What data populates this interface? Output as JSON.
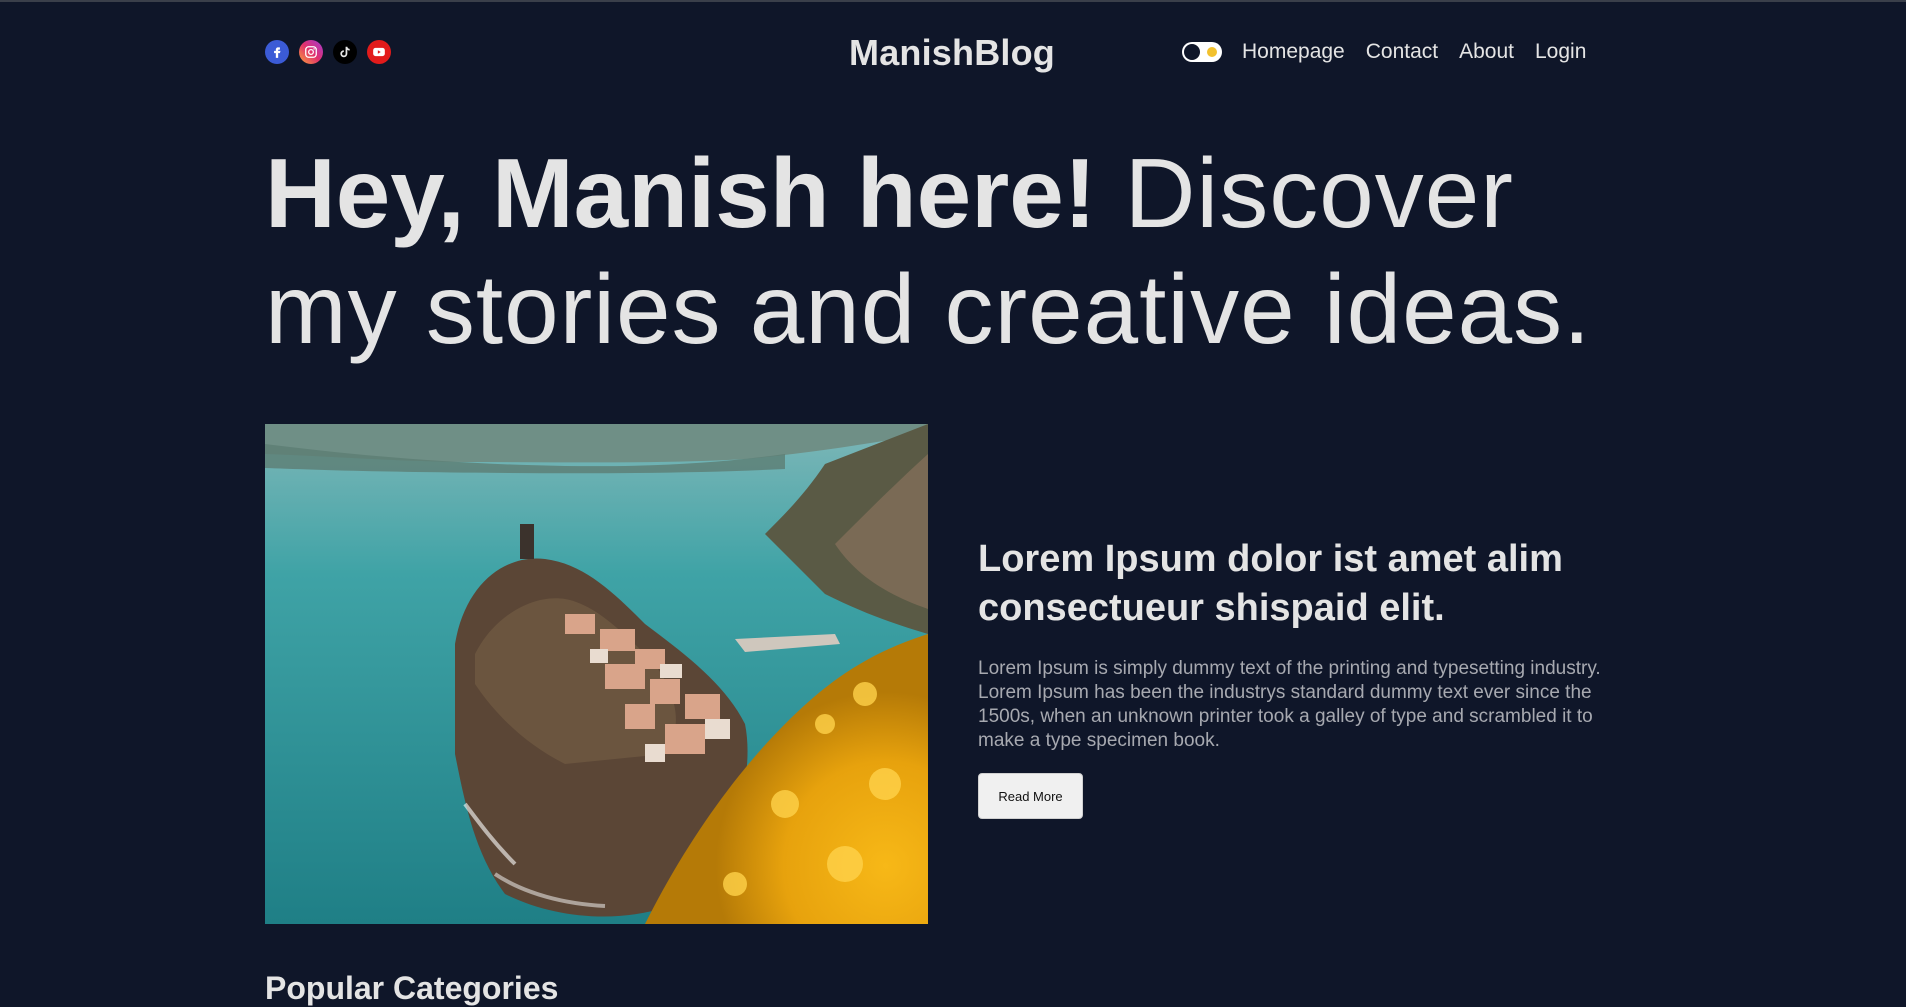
{
  "navbar": {
    "brand": "ManishBlog",
    "socials": [
      {
        "icon": "facebook-icon",
        "color": "#3b5bd6"
      },
      {
        "icon": "instagram-icon",
        "color": "#e1306c"
      },
      {
        "icon": "tiktok-icon",
        "color": "#000000"
      },
      {
        "icon": "youtube-icon",
        "color": "#e21b1b"
      }
    ],
    "links": [
      "Homepage",
      "Contact",
      "About",
      "Login"
    ],
    "theme_toggle": {
      "icon": "sun-icon",
      "accent": "#f2c12e"
    }
  },
  "hero": {
    "bold": "Hey, Manish here!",
    "rest": " Discover my stories and creative ideas."
  },
  "featured": {
    "image": "coastal-cliff-village-photo",
    "title": "Lorem Ipsum dolor ist amet alim consectueur shispaid elit.",
    "description": "Lorem Ipsum is simply dummy text of the printing and typesetting industry. Lorem Ipsum has been the industrys standard dummy text ever since the 1500s, when an unknown printer took a galley of type and scrambled it to make a type specimen book.",
    "button_label": "Read More"
  },
  "sections": {
    "next_heading": "Popular Categories"
  },
  "colors": {
    "background": "#0f1629",
    "text": "#e4e4e4",
    "muted": "#a7a9b0"
  }
}
